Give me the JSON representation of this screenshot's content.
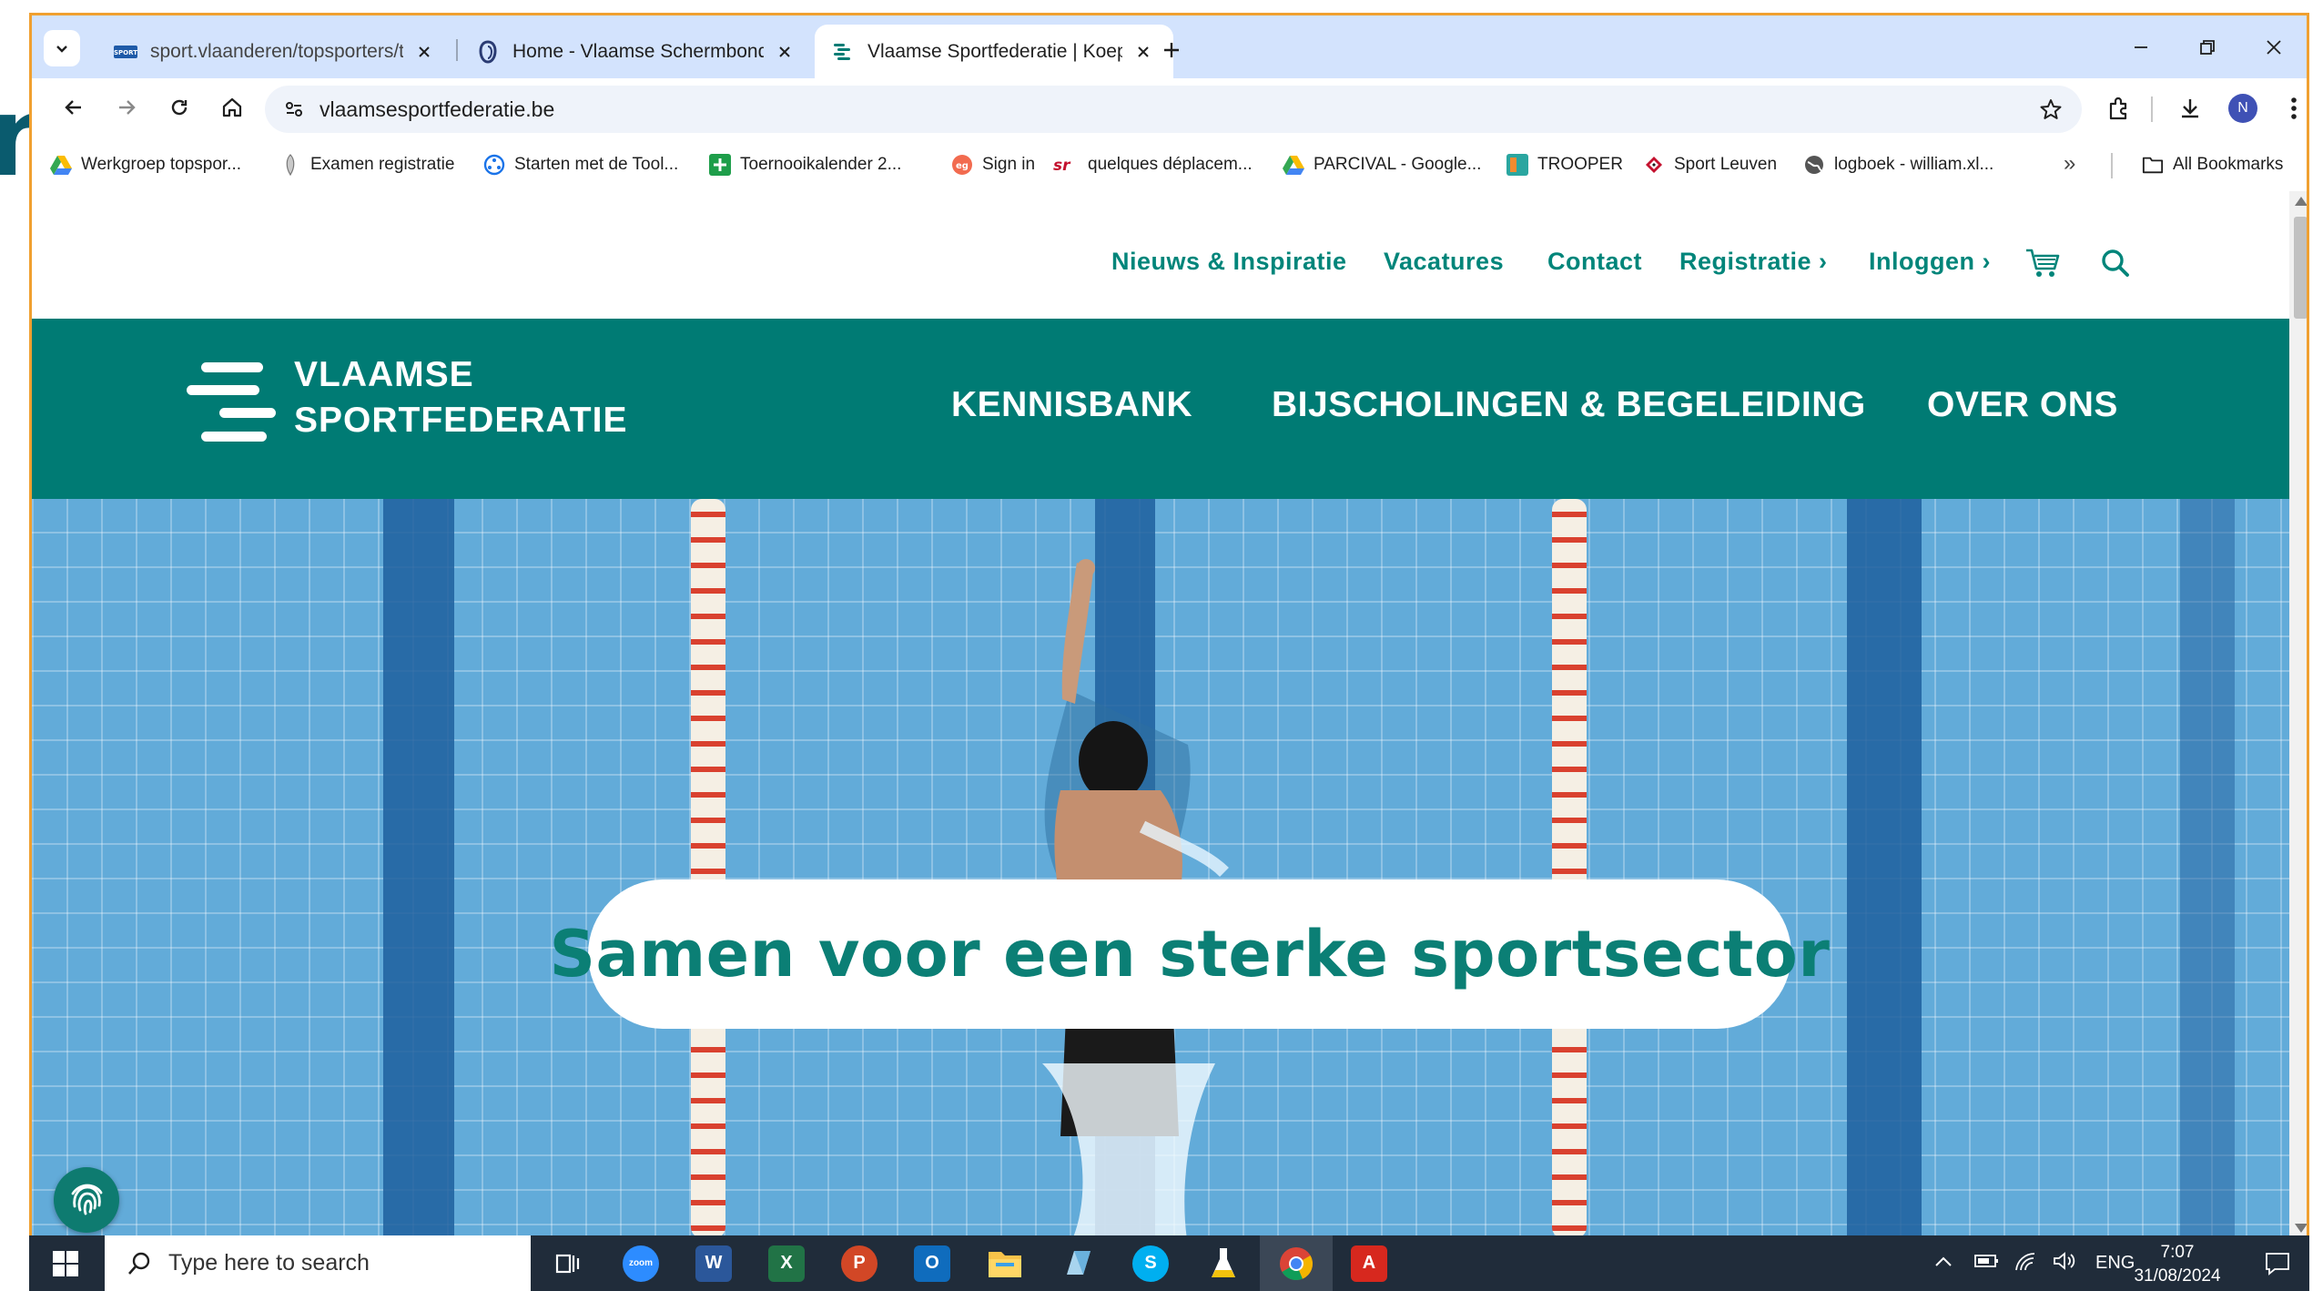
{
  "browser": {
    "tabs": [
      {
        "title": "sport.vlaanderen/topsporters/t",
        "icon": "sport-vlaanderen-favicon",
        "active": false
      },
      {
        "title": "Home - Vlaamse Schermbond",
        "icon": "schermbond-favicon",
        "active": false
      },
      {
        "title": "Vlaamse Sportfederatie | Koepe",
        "icon": "vsf-favicon",
        "active": true
      }
    ],
    "new_tab_symbol": "+",
    "url": "vlaamsesportfederatie.be",
    "profile_initial": "N",
    "bookmarks": [
      {
        "label": "Werkgroep topspor...",
        "icon": "google-drive-icon"
      },
      {
        "label": "Examen registratie",
        "icon": "feather-icon"
      },
      {
        "label": "Starten met de Tool...",
        "icon": "tool-icon"
      },
      {
        "label": "Toernooikalender 2...",
        "icon": "green-plus-icon"
      },
      {
        "label": "Sign in",
        "icon": "sign-in-icon"
      },
      {
        "label": "quelques déplacem...",
        "icon": "sr-icon"
      },
      {
        "label": "PARCIVAL - Google...",
        "icon": "google-drive-icon"
      },
      {
        "label": "TROOPER",
        "icon": "trooper-icon"
      },
      {
        "label": "Sport Leuven",
        "icon": "sport-leuven-icon"
      },
      {
        "label": "logboek - william.xl...",
        "icon": "globe-icon"
      }
    ],
    "more_bookmarks": "»",
    "all_bookmarks": "All Bookmarks"
  },
  "site": {
    "top_nav": [
      "Nieuws & Inspiratie",
      "Vacatures",
      "Contact",
      "Registratie ›",
      "Inloggen ›"
    ],
    "logo_line1": "VLAAMSE",
    "logo_line2": "SPORTFEDERATIE",
    "main_nav": [
      "KENNISBANK",
      "BIJSCHOLINGEN & BEGELEIDING",
      "OVER ONS"
    ],
    "tagline": "Samen voor een sterke sportsector",
    "colors": {
      "accent": "#007b74",
      "text_accent": "#00857a"
    }
  },
  "taskbar": {
    "search_placeholder": "Type here to search",
    "apps": [
      "task-view",
      "zoom",
      "word",
      "excel",
      "powerpoint",
      "outlook",
      "file-explorer",
      "notepad",
      "skype",
      "flask-app",
      "chrome",
      "acrobat"
    ],
    "language": "ENG",
    "time": "7:07",
    "date": "31/08/2024"
  },
  "stray_glyph": "n"
}
